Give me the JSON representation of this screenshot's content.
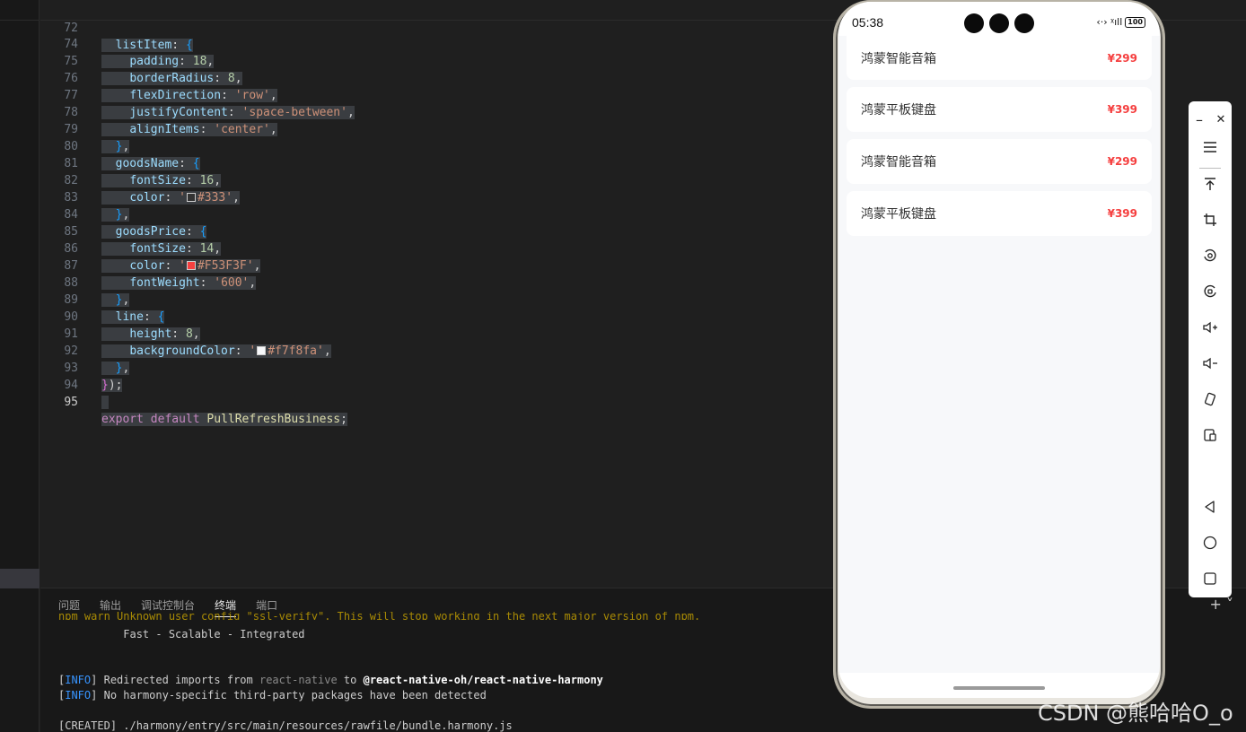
{
  "editor": {
    "lines": [
      {
        "no": "72",
        "text": "  listItem: {"
      },
      {
        "no": "74",
        "text": "    padding: 18,"
      },
      {
        "no": "75",
        "text": "    borderRadius: 8,"
      },
      {
        "no": "76",
        "text": "    flexDirection: 'row',"
      },
      {
        "no": "77",
        "text": "    justifyContent: 'space-between',"
      },
      {
        "no": "78",
        "text": "    alignItems: 'center',"
      },
      {
        "no": "79",
        "text": "  },"
      },
      {
        "no": "80",
        "text": "  goodsName: {"
      },
      {
        "no": "81",
        "text": "    fontSize: 16,"
      },
      {
        "no": "82",
        "text": "    color: '#333',"
      },
      {
        "no": "83",
        "text": "  },"
      },
      {
        "no": "84",
        "text": "  goodsPrice: {"
      },
      {
        "no": "85",
        "text": "    fontSize: 14,"
      },
      {
        "no": "86",
        "text": "    color: '#F53F3F',"
      },
      {
        "no": "87",
        "text": "    fontWeight: '600',"
      },
      {
        "no": "88",
        "text": "  },"
      },
      {
        "no": "89",
        "text": "  line: {"
      },
      {
        "no": "90",
        "text": "    height: 8,"
      },
      {
        "no": "91",
        "text": "    backgroundColor: '#f7f8fa',"
      },
      {
        "no": "92",
        "text": "  },"
      },
      {
        "no": "93",
        "text": "});"
      },
      {
        "no": "94",
        "text": ""
      },
      {
        "no": "95",
        "text": "export default PullRefreshBusiness;"
      }
    ],
    "swatch_colors": {
      "line82": "#333333",
      "line86": "#F53F3F",
      "line91": "#f7f8fa"
    }
  },
  "panel": {
    "tabs": [
      "问题",
      "输出",
      "调试控制台",
      "终端",
      "端口"
    ],
    "active_tab": "终端",
    "terminal": {
      "line0": "npm warn Unknown user config \"ssl-verify\". This will stop working in the next major version of npm.",
      "line1": "          Fast - Scalable - Integrated",
      "line2_tag": "INFO",
      "line2_a": "] Redirected imports from ",
      "line2_b": "react-native",
      "line2_c": " to ",
      "line2_d": "@react-native-oh/react-native-harmony",
      "line3_tag": "INFO",
      "line3_a": "] No harmony-specific third-party packages have been detected",
      "line4_tag": "CREATED",
      "line4_a": "] ./harmony/entry/src/main/resources/rawfile/bundle.harmony.js"
    },
    "add_icon": "plus-icon"
  },
  "phone": {
    "time": "05:38",
    "battery": "100",
    "signal": "‹·› ᵡıll",
    "goods": [
      {
        "name": "鸿蒙智能音箱",
        "price": "¥299"
      },
      {
        "name": "鸿蒙平板键盘",
        "price": "¥399"
      },
      {
        "name": "鸿蒙智能音箱",
        "price": "¥299"
      },
      {
        "name": "鸿蒙平板键盘",
        "price": "¥399"
      }
    ],
    "colors": {
      "name": "#333333",
      "price": "#F53F3F",
      "bg": "#f7f8fa"
    }
  },
  "emulator_toolbar": {
    "minimize": "–",
    "close": "✕",
    "icons": [
      "menu-icon",
      "pin-top-icon",
      "crop-icon",
      "rotate-icon",
      "screenshot-icon",
      "volume-up-icon",
      "volume-down-icon",
      "shake-icon",
      "fold-icon",
      "back-icon",
      "home-icon",
      "recents-icon"
    ]
  },
  "watermark": "CSDN @熊哈哈O_o"
}
